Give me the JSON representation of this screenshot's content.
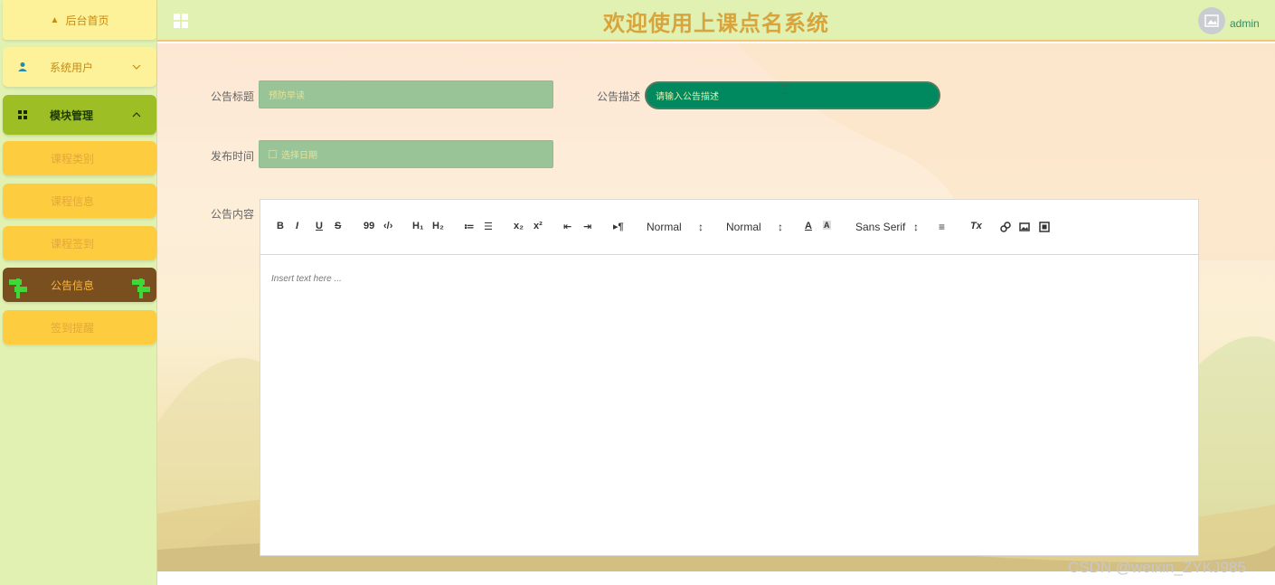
{
  "header": {
    "title": "欢迎使用上课点名系统",
    "username": "admin"
  },
  "sidebar": {
    "home": "后台首页",
    "users": "系统用户",
    "modules": "模块管理",
    "subitems": [
      "课程类别",
      "课程信息",
      "课程签到",
      "公告信息",
      "签到提醒"
    ],
    "active_index": 3
  },
  "form": {
    "title_label": "公告标题",
    "title_value": "预防早读",
    "desc_label": "公告描述",
    "desc_placeholder": "请输入公告描述",
    "time_label": "发布时间",
    "time_placeholder": "选择日期",
    "content_label": "公告内容"
  },
  "editor": {
    "toolbar": {
      "bold": "B",
      "italic": "I",
      "underline": "U",
      "strike": "S",
      "blockquote": "99",
      "code": "‹/›",
      "h1": "H₁",
      "h2": "H₂",
      "ordered": "≔",
      "bullet": "☰",
      "sub": "x₂",
      "sup": "x²",
      "outdent": "⇤",
      "indent": "⇥",
      "rtl": "▸¶",
      "size1": "Normal",
      "size2": "Normal",
      "font": "Sans Serif",
      "clean": "Tx"
    },
    "placeholder": "Insert text here ..."
  },
  "watermark": "CSDN @weixin_ZYKJ985",
  "colors": {
    "sidebar_bg": "#e0f1b2",
    "title_color": "#d8a43b",
    "active_bg": "#7a4f1f",
    "desc_input_bg": "#00895f"
  }
}
